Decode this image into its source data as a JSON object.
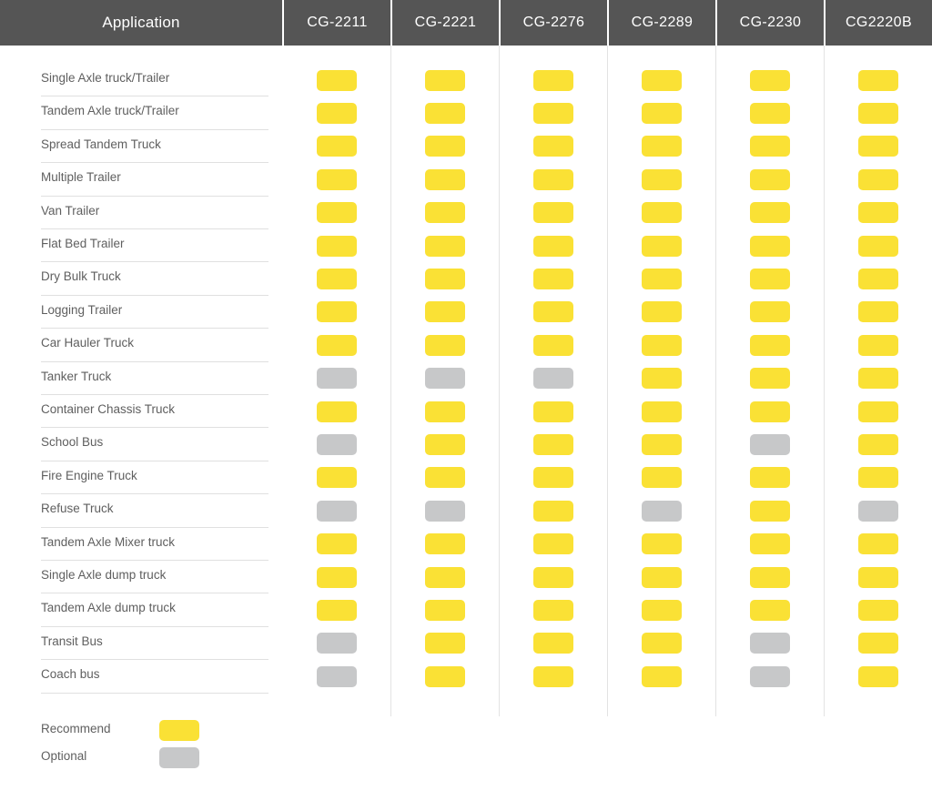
{
  "header": {
    "application_label": "Application",
    "columns": [
      "CG-2211",
      "CG-2221",
      "CG-2276",
      "CG-2289",
      "CG-2230",
      "CG2220B"
    ],
    "background_color": "#555555",
    "text_color": "#ffffff"
  },
  "legend": {
    "items": [
      {
        "label": "Recommend",
        "state": "recommend",
        "color": "#fae135"
      },
      {
        "label": "Optional",
        "state": "optional",
        "color": "#c7c8c9"
      }
    ]
  },
  "colors": {
    "recommend": "#fae135",
    "optional": "#c7c8c9",
    "header_bg": "#555555",
    "row_rule": "#e0e0e0",
    "col_rule": "#e3e3e3",
    "label_text": "#5f5f5f"
  },
  "chart_data": {
    "type": "table",
    "title": "Application Compatibility Matrix",
    "categories": [
      "Single Axle truck/Trailer",
      "Tandem Axle truck/Trailer",
      "Spread Tandem Truck",
      "Multiple Trailer",
      "Van Trailer",
      "Flat Bed Trailer",
      "Dry Bulk Truck",
      "Logging Trailer",
      "Car Hauler Truck",
      "Tanker Truck",
      "Container Chassis Truck",
      "School Bus",
      "Fire Engine Truck",
      "Refuse Truck",
      "Tandem Axle Mixer truck",
      "Single Axle dump truck",
      "Tandem Axle dump truck",
      "Transit Bus",
      "Coach bus"
    ],
    "columns": [
      "CG-2211",
      "CG-2221",
      "CG-2276",
      "CG-2289",
      "CG-2230",
      "CG2220B"
    ],
    "legend": [
      "Recommend",
      "Optional"
    ],
    "rows": [
      {
        "application": "Single Axle truck/Trailer",
        "values": [
          "recommend",
          "recommend",
          "recommend",
          "recommend",
          "recommend",
          "recommend"
        ]
      },
      {
        "application": "Tandem Axle truck/Trailer",
        "values": [
          "recommend",
          "recommend",
          "recommend",
          "recommend",
          "recommend",
          "recommend"
        ]
      },
      {
        "application": "Spread Tandem Truck",
        "values": [
          "recommend",
          "recommend",
          "recommend",
          "recommend",
          "recommend",
          "recommend"
        ]
      },
      {
        "application": "Multiple Trailer",
        "values": [
          "recommend",
          "recommend",
          "recommend",
          "recommend",
          "recommend",
          "recommend"
        ]
      },
      {
        "application": "Van Trailer",
        "values": [
          "recommend",
          "recommend",
          "recommend",
          "recommend",
          "recommend",
          "recommend"
        ]
      },
      {
        "application": "Flat Bed Trailer",
        "values": [
          "recommend",
          "recommend",
          "recommend",
          "recommend",
          "recommend",
          "recommend"
        ]
      },
      {
        "application": "Dry Bulk Truck",
        "values": [
          "recommend",
          "recommend",
          "recommend",
          "recommend",
          "recommend",
          "recommend"
        ]
      },
      {
        "application": "Logging Trailer",
        "values": [
          "recommend",
          "recommend",
          "recommend",
          "recommend",
          "recommend",
          "recommend"
        ]
      },
      {
        "application": "Car Hauler Truck",
        "values": [
          "recommend",
          "recommend",
          "recommend",
          "recommend",
          "recommend",
          "recommend"
        ]
      },
      {
        "application": "Tanker Truck",
        "values": [
          "optional",
          "optional",
          "optional",
          "recommend",
          "recommend",
          "recommend"
        ]
      },
      {
        "application": "Container Chassis Truck",
        "values": [
          "recommend",
          "recommend",
          "recommend",
          "recommend",
          "recommend",
          "recommend"
        ]
      },
      {
        "application": "School Bus",
        "values": [
          "optional",
          "recommend",
          "recommend",
          "recommend",
          "optional",
          "recommend"
        ]
      },
      {
        "application": "Fire Engine Truck",
        "values": [
          "recommend",
          "recommend",
          "recommend",
          "recommend",
          "recommend",
          "recommend"
        ]
      },
      {
        "application": "Refuse Truck",
        "values": [
          "optional",
          "optional",
          "recommend",
          "optional",
          "recommend",
          "optional"
        ]
      },
      {
        "application": "Tandem Axle Mixer truck",
        "values": [
          "recommend",
          "recommend",
          "recommend",
          "recommend",
          "recommend",
          "recommend"
        ]
      },
      {
        "application": "Single Axle dump truck",
        "values": [
          "recommend",
          "recommend",
          "recommend",
          "recommend",
          "recommend",
          "recommend"
        ]
      },
      {
        "application": "Tandem Axle dump truck",
        "values": [
          "recommend",
          "recommend",
          "recommend",
          "recommend",
          "recommend",
          "recommend"
        ]
      },
      {
        "application": "Transit Bus",
        "values": [
          "optional",
          "recommend",
          "recommend",
          "recommend",
          "optional",
          "recommend"
        ]
      },
      {
        "application": "Coach bus",
        "values": [
          "optional",
          "recommend",
          "recommend",
          "recommend",
          "optional",
          "recommend"
        ]
      }
    ]
  }
}
